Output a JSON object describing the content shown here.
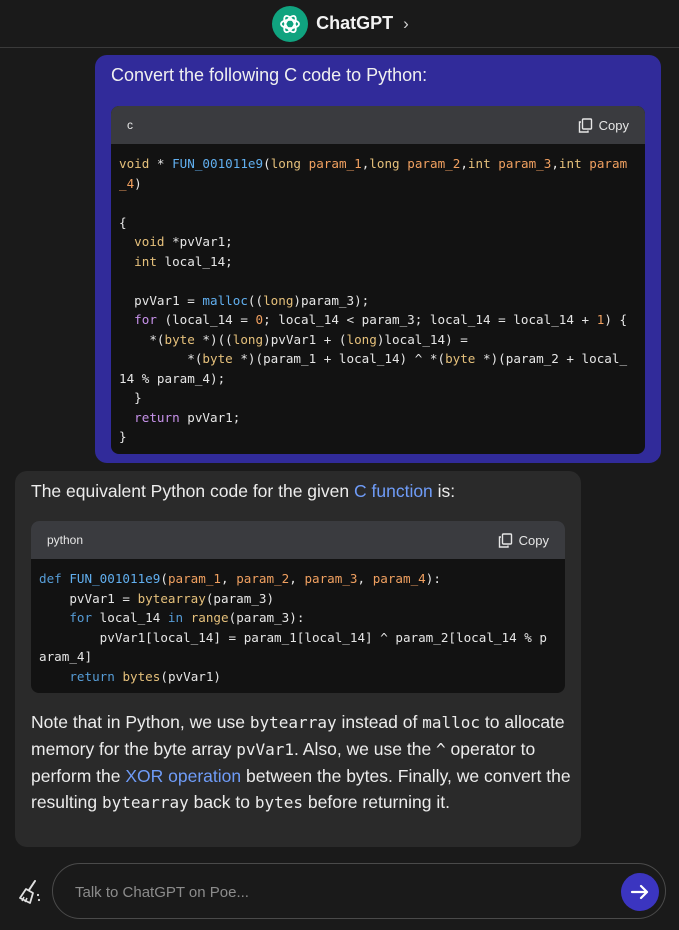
{
  "header": {
    "title": "ChatGPT",
    "chevron": "›"
  },
  "user_message": {
    "text": "Convert the following C code to Python:",
    "code": {
      "language": "c",
      "copy_label": "Copy"
    }
  },
  "bot_message": {
    "intro_before": "The equivalent Python code for the given ",
    "intro_link": "C function",
    "intro_after": " is:",
    "code": {
      "language": "python",
      "copy_label": "Copy"
    },
    "note": {
      "p1": "Note that in Python, we use ",
      "c1": "bytearray",
      "p2": " instead of ",
      "c2": "malloc",
      "p3": " to allocate memory for the byte array ",
      "c3": "pvVar1",
      "p4": ". Also, we use the ",
      "c4": "^",
      "p5": " operator to perform the ",
      "link": "XOR operation",
      "p6": " between the bytes. Finally, we convert the resulting ",
      "c5": "bytearray",
      "p7": " back to ",
      "c6": "bytes",
      "p8": " before returning it."
    }
  },
  "composer": {
    "placeholder": "Talk to ChatGPT on Poe..."
  },
  "icons": {
    "logo": "openai-logo-icon",
    "copy": "copy-icon",
    "send": "arrow-right-icon",
    "clear": "broom-icon"
  },
  "colors": {
    "accent": "#312b9a",
    "send": "#3b35c0",
    "link": "#6f9cf8"
  }
}
